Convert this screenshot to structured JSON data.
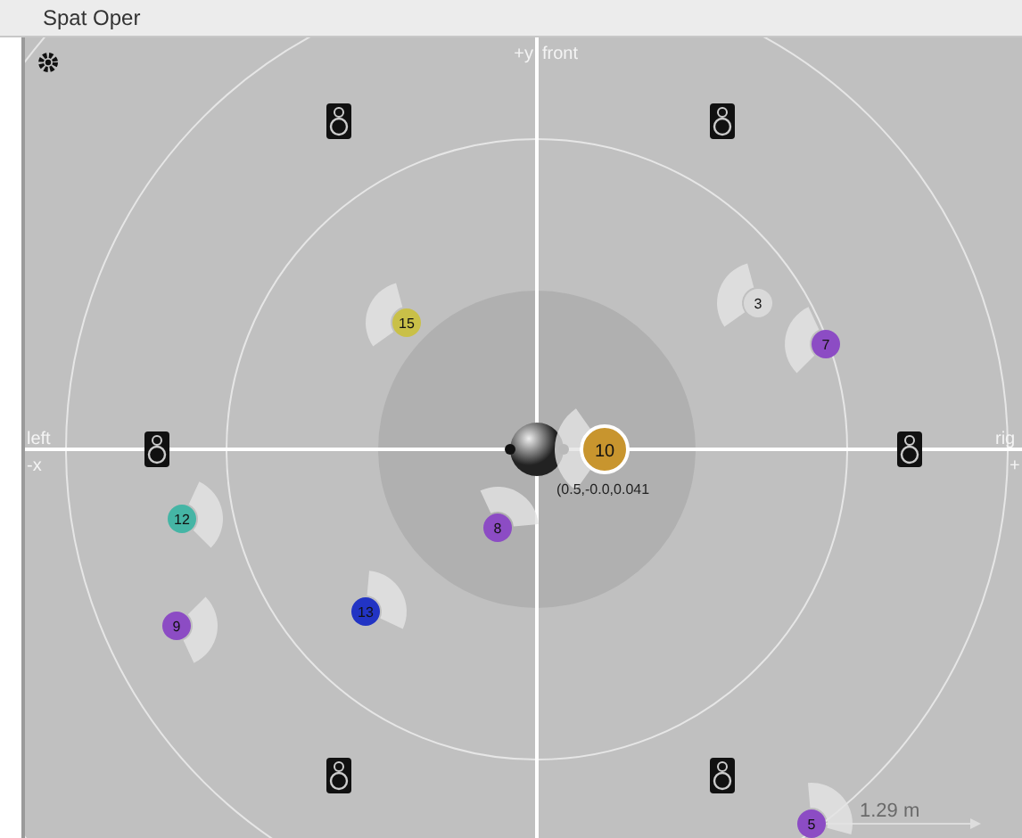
{
  "window": {
    "title": "Spat Oper"
  },
  "axis_labels": {
    "top_left": "+y",
    "top_right": "front",
    "left_upper": "left",
    "left_lower": "-x",
    "right_upper": "rig",
    "right_lower": "+"
  },
  "sources": [
    {
      "label": "15",
      "color": "#c9c048",
      "selected": false
    },
    {
      "label": "3",
      "color": "#d9d9d9",
      "selected": false
    },
    {
      "label": "7",
      "color": "#8c4cc4",
      "selected": false
    },
    {
      "label": "10",
      "color": "#c8952e",
      "selected": true
    },
    {
      "label": "8",
      "color": "#8c4cc4",
      "selected": false
    },
    {
      "label": "12",
      "color": "#45b5a5",
      "selected": false
    },
    {
      "label": "13",
      "color": "#2234c4",
      "selected": false
    },
    {
      "label": "9",
      "color": "#8c4cc4",
      "selected": false
    },
    {
      "label": "5",
      "color": "#8c4cc4",
      "selected": false
    }
  ],
  "selected_position": "(0.5,-0.0,0.041",
  "scale": "1.29 m"
}
